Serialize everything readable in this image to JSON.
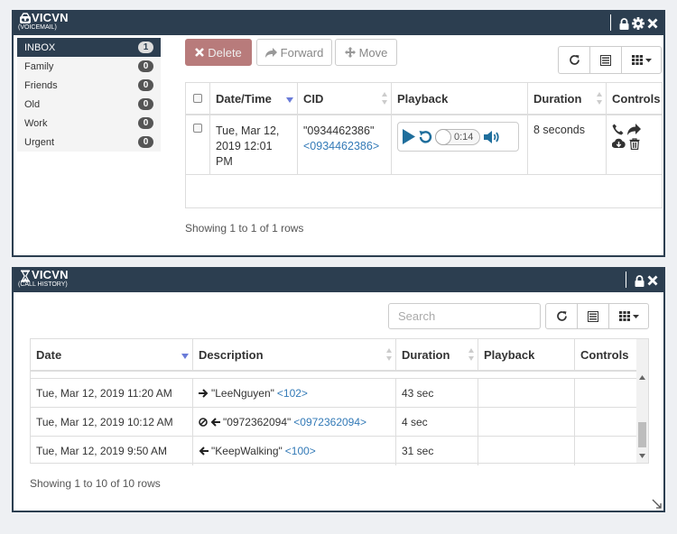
{
  "voicemail": {
    "title": "VICVN",
    "subtitle": "(VOICEMAIL)",
    "folders": [
      {
        "name": "INBOX",
        "count": "1"
      },
      {
        "name": "Family",
        "count": "0"
      },
      {
        "name": "Friends",
        "count": "0"
      },
      {
        "name": "Old",
        "count": "0"
      },
      {
        "name": "Work",
        "count": "0"
      },
      {
        "name": "Urgent",
        "count": "0"
      }
    ],
    "toolbar": {
      "delete": "Delete",
      "forward": "Forward",
      "move": "Move"
    },
    "columns": {
      "datetime": "Date/Time",
      "cid": "CID",
      "playback": "Playback",
      "duration": "Duration",
      "controls": "Controls"
    },
    "rows": [
      {
        "date_line1": "Tue, Mar 12,",
        "date_line2": "2019 12:01",
        "date_line3": "PM",
        "cid_name": "\"0934462386\"",
        "cid_number": "<0934462386>",
        "duration": "8 seconds",
        "player_time": "0:14"
      }
    ],
    "footer": "Showing 1 to 1 of 1 rows"
  },
  "call_history": {
    "title": "VICVN",
    "subtitle": "(CALL HISTORY)",
    "search_placeholder": "Search",
    "columns": {
      "date": "Date",
      "description": "Description",
      "duration": "Duration",
      "playback": "Playback",
      "controls": "Controls"
    },
    "rows": [
      {
        "date": "Tue, Mar 12, 2019 11:20 AM",
        "direction": "outbound",
        "name": "\"LeeNguyen\"",
        "number": "<102>",
        "duration": "43 sec"
      },
      {
        "date": "Tue, Mar 12, 2019 10:12 AM",
        "direction": "missed-inbound",
        "name": "\"0972362094\"",
        "number": "<0972362094>",
        "duration": "4 sec"
      },
      {
        "date": "Tue, Mar 12, 2019 9:50 AM",
        "direction": "inbound",
        "name": "\"KeepWalking\"",
        "number": "<100>",
        "duration": "31 sec"
      }
    ],
    "footer": "Showing 1 to 10 of 10 rows"
  },
  "colors": {
    "header": "#2c3e50",
    "danger": "#b87b7b",
    "link": "#337ab7",
    "player": "#1f6e9c"
  }
}
